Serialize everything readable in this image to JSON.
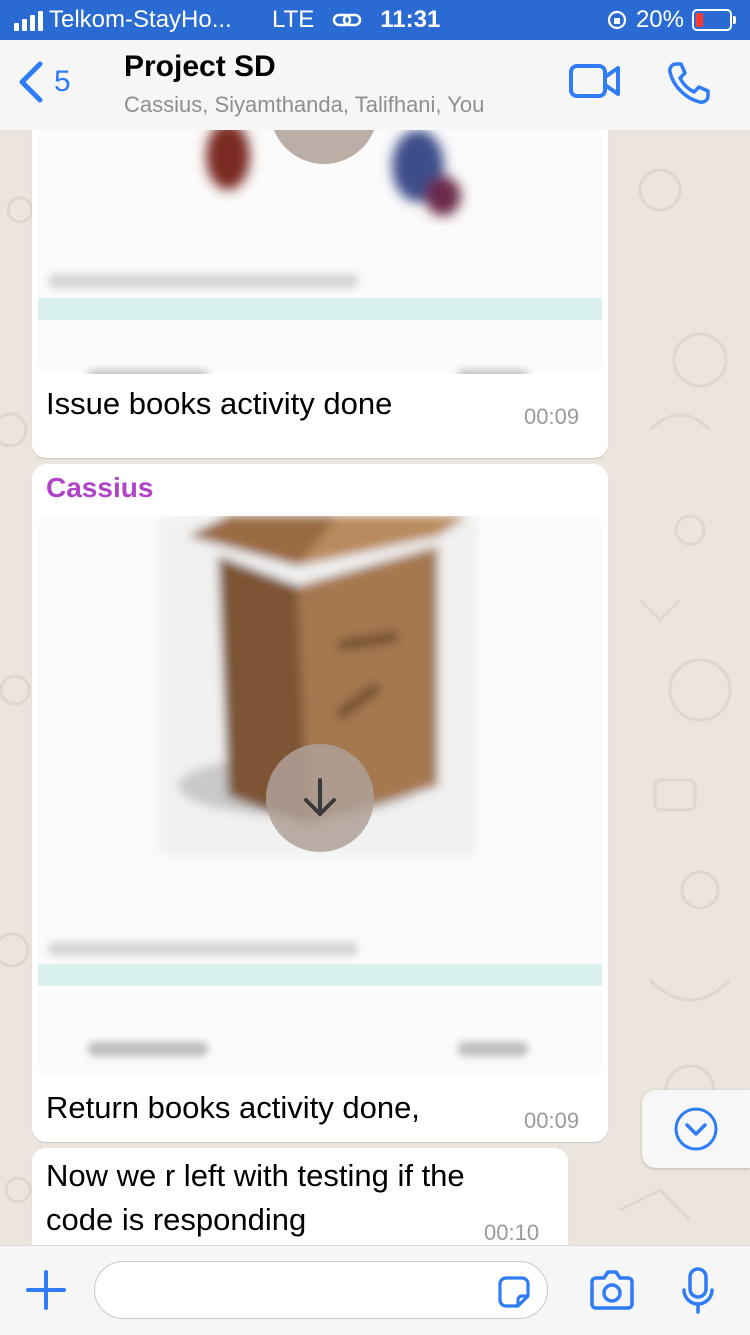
{
  "status_bar": {
    "carrier": "Telkom-StayHo...",
    "network": "LTE",
    "time": "11:31",
    "battery": "20%"
  },
  "header": {
    "back_count": "5",
    "title": "Project SD",
    "subtitle": "Cassius, Siyamthanda, Talifhani, You"
  },
  "messages": [
    {
      "text": "Issue books activity done",
      "time": "00:09"
    },
    {
      "sender": "Cassius",
      "text": "Return books activity done,",
      "time": "00:09"
    },
    {
      "text": "Now we r left with testing if the code is responding",
      "time": "00:10"
    }
  ],
  "input": {
    "value": "",
    "placeholder": ""
  },
  "colors": {
    "accent": "#2f7cf6",
    "status_bar": "#2a6ad3",
    "sender_name": "#b043c8",
    "chat_background": "#ece5dd"
  },
  "icons": {
    "back": "chevron-left-icon",
    "video_call": "video-camera-icon",
    "voice_call": "phone-icon",
    "download": "arrow-down-icon",
    "scroll_down": "chevron-down-circle-icon",
    "attach": "plus-icon",
    "sticker": "sticker-icon",
    "camera": "camera-icon",
    "mic": "microphone-icon"
  }
}
